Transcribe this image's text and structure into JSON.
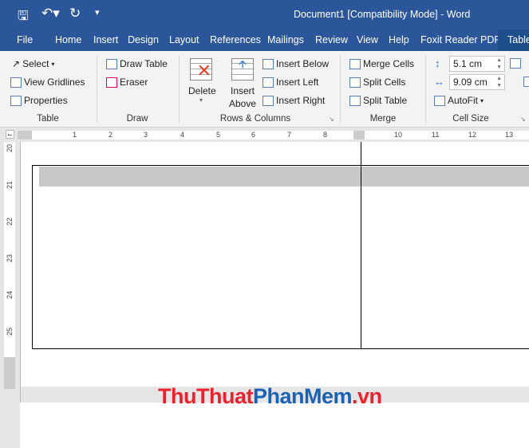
{
  "titlebar": {
    "title": "Document1 [Compatibility Mode]  -  Word",
    "icons": [
      "save-icon",
      "undo-icon",
      "redo-icon",
      "customize-qat-icon"
    ]
  },
  "tabs": [
    "File",
    "Home",
    "Insert",
    "Design",
    "Layout",
    "References",
    "Mailings",
    "Review",
    "View",
    "Help",
    "Foxit Reader PDF",
    "Table"
  ],
  "ribbon": {
    "table": {
      "select": "Select",
      "view_gridlines": "View Gridlines",
      "properties": "Properties",
      "label": "Table"
    },
    "draw": {
      "draw_table": "Draw Table",
      "eraser": "Eraser",
      "label": "Draw"
    },
    "rows_columns": {
      "delete": "Delete",
      "insert": "Insert",
      "above": "Above",
      "insert_below": "Insert Below",
      "insert_left": "Insert Left",
      "insert_right": "Insert Right",
      "label": "Rows & Columns"
    },
    "merge": {
      "merge_cells": "Merge Cells",
      "split_cells": "Split Cells",
      "split_table": "Split Table",
      "label": "Merge"
    },
    "cell_size": {
      "height": "5.1 cm",
      "width": "9.09 cm",
      "autofit": "AutoFit",
      "label": "Cell Size"
    }
  },
  "ruler": {
    "h_numbers": [
      "1",
      "2",
      "3",
      "4",
      "5",
      "6",
      "7",
      "8",
      "10",
      "11",
      "12",
      "13"
    ],
    "v_numbers": [
      "20",
      "21",
      "22",
      "23",
      "24",
      "25"
    ]
  },
  "watermark": {
    "part1": "ThuThuat",
    "part2": "PhanMem",
    "part3": ".vn",
    "colors": [
      "#e8232e",
      "#1b62b4"
    ]
  },
  "colors": {
    "accent": "#2b579a",
    "selected_row": "#c8c8c8"
  }
}
